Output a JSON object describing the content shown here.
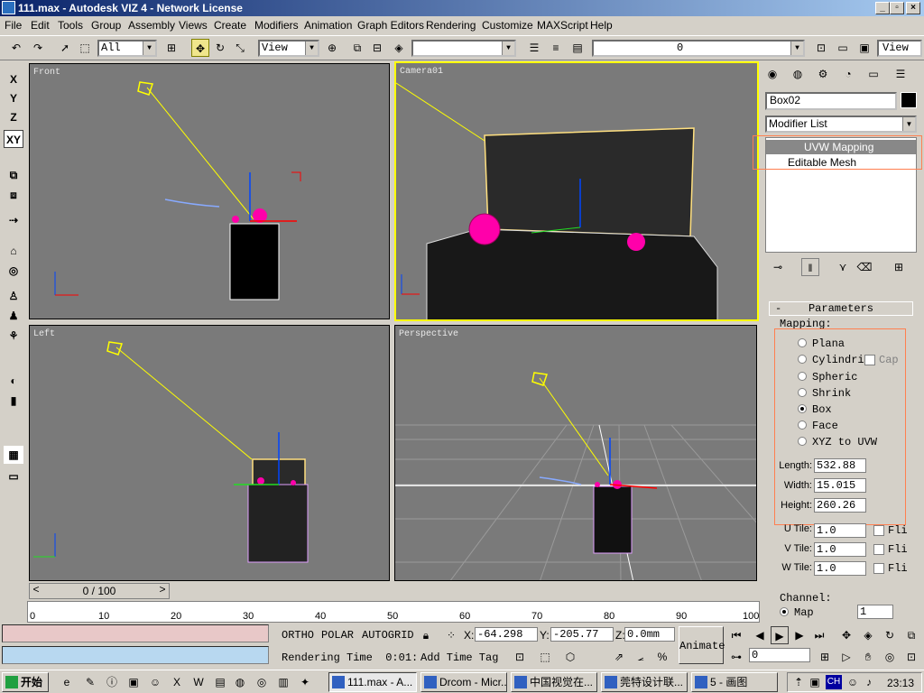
{
  "window": {
    "title": "111.max - Autodesk VIZ 4 - Network License"
  },
  "menu": [
    "File",
    "Edit",
    "Tools",
    "Group",
    "Assembly",
    "Views",
    "Create",
    "Modifiers",
    "Animation",
    "Graph Editors",
    "Rendering",
    "Customize",
    "MAXScript",
    "Help"
  ],
  "toolbar": {
    "selection_filter": "All",
    "coord_system": "View",
    "named_selection": "",
    "layer_value": "0",
    "view_label": "View"
  },
  "axis_buttons": [
    "X",
    "Y",
    "Z",
    "XY"
  ],
  "viewports": {
    "front": "Front",
    "camera": "Camera01",
    "left": "Left",
    "perspective": "Perspective"
  },
  "command_panel": {
    "object_name": "Box02",
    "modifier_list": "Modifier List",
    "stack": [
      "UVW Mapping",
      "Editable Mesh"
    ],
    "rollout_title": "Parameters",
    "mapping_label": "Mapping:",
    "mapping_options": [
      "Plana",
      "Cylindri",
      "Spheric",
      "Shrink",
      "Box",
      "Face",
      "XYZ to UVW"
    ],
    "cap_label": "Cap",
    "length_label": "Length:",
    "length_value": "532.88",
    "width_label": "Width:",
    "width_value": "15.015",
    "height_label": "Height:",
    "height_value": "260.26",
    "utile_label": "U Tile:",
    "utile_value": "1.0",
    "vtile_label": "V Tile:",
    "vtile_value": "1.0",
    "wtile_label": "W Tile:",
    "wtile_value": "1.0",
    "flip_label": "Fli",
    "channel_label": "Channel:",
    "map_label": "Map",
    "channel_value": "1"
  },
  "timeline": {
    "frame_label": "0 / 100",
    "ticks": [
      "0",
      "10",
      "20",
      "30",
      "40",
      "50",
      "60",
      "70",
      "80",
      "90",
      "100"
    ]
  },
  "status": {
    "ortho": "ORTHO",
    "polar": "POLAR",
    "autogrid": "AUTOGRID",
    "x_label": "X:",
    "x_value": "-64.298",
    "y_label": "Y:",
    "y_value": "-205.77",
    "z_label": "Z:",
    "z_value": "0.0mm",
    "rendering_time": "Rendering Time  0:01:",
    "add_time_tag": "Add Time Tag",
    "animate": "Animate",
    "frame_value": "0"
  },
  "taskbar": {
    "start": "开始",
    "tasks": [
      "111.max - A...",
      "Drcom - Micr...",
      "中国视觉在...",
      "莞特设计联...",
      "5 - 画图"
    ],
    "ime": "CH",
    "clock": "23:13"
  }
}
